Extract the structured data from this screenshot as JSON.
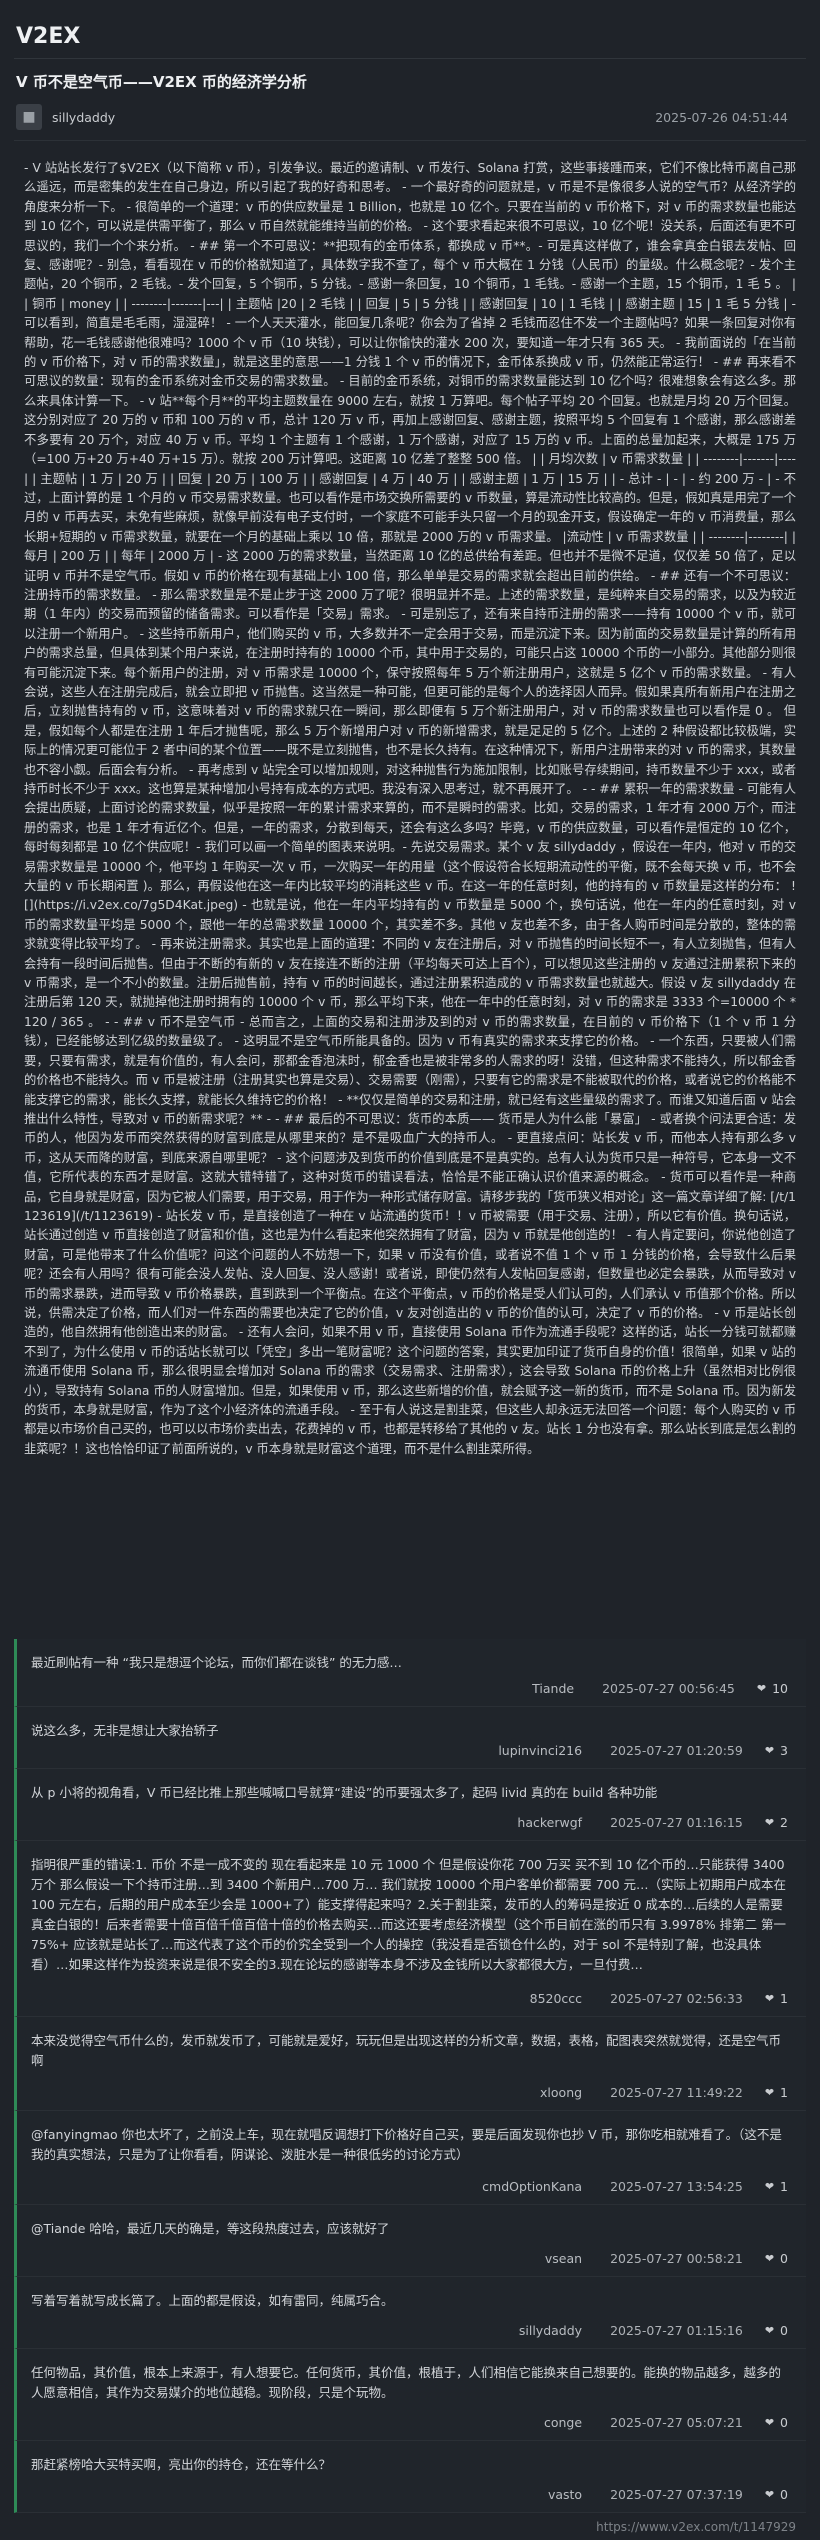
{
  "site": {
    "logo": "V2EX"
  },
  "topic": {
    "title": "V 币不是空气币——V2EX 币的经济学分析",
    "author": "sillydaddy",
    "date": "2025-07-26 04:51:44",
    "body": "- V 站站长发行了$V2EX（以下简称 v 币），引发争议。最近的邀请制、v 币发行、Solana 打赏，这些事接踵而来，它们不像比特币离自己那么遥远，而是密集的发生在自己身边，所以引起了我的好奇和思考。 - 一个最好奇的问题就是，v 币是不是像很多人说的空气币？从经济学的角度来分析一下。 - 很简单的一个道理：v 币的供应数量是 1 Billion，也就是 10 亿个。只要在当前的 v 币价格下，对 v 币的需求数量也能达到 10 亿个，可以说是供需平衡了，那么 v 币自然就能维持当前的价格。 - 这个要求看起来很不可思议，10 亿个呢！没关系，后面还有更不可思议的，我们一个个来分析。 - ## 第一个不可思议：**把现有的金币体系，都换成 v 币**。- 可是真这样做了，谁会拿真金白银去发帖、回复、感谢呢？- 别急，看看现在 v 币的价格就知道了，具体数字我不查了，每个 v 币大概在 1 分钱（人民币）的量级。什么概念呢？- 发个主题帖，20 个铜币，2 毛钱。- 发个回复，5 个铜币，5 分钱。- 感谢一条回复，10 个铜币，1 毛钱。- 感谢一个主题，15 个铜币，1 毛 5 。 | | 铜币 | money | | --------|-------|---| | 主题帖 |20 | 2 毛钱 | | 回复 | 5 | 5 分钱 | | 感谢回复 | 10 | 1 毛钱 | | 感谢主题 | 15 | 1 毛 5 分钱 | - 可以看到，简直是毛毛雨，湿湿碎！ - 一个人天天灌水，能回复几条呢？你会为了省掉 2 毛钱而忍住不发一个主题帖吗？如果一条回复对你有帮助，花一毛钱感谢他很难吗？1000 个 v 币（10 块钱），可以让你愉快的灌水 200 次，要知道一年才只有 365 天。 - 我前面说的「在当前的 v 币价格下，对 v 币的需求数量」，就是这里的意思——1 分钱 1 个 v 币的情况下，金币体系换成 v 币，仍然能正常运行！ - ## 再来看不可思议的数量：现有的金币系统对金币交易的需求数量。 - 目前的金币系统，对铜币的需求数量能达到 10 亿个吗？很难想象会有这么多。那么来具体计算一下。 - v 站**每个月**的平均主题数量在 9000 左右，就按 1 万算吧。每个帖子平均 20 个回复。也就是月均 20 万个回复。这分别对应了 20 万的 v 币和 100 万的 v 币，总计 120 万 v 币，再加上感谢回复、感谢主题，按照平均 5 个回复有 1 个感谢，那么感谢差不多要有 20 万个，对应 40 万 v 币。平均 1 个主题有 1 个感谢，1 万个感谢，对应了 15 万的 v 币。上面的总量加起来，大概是 175 万（=100 万+20 万+40 万+15 万）。就按 200 万计算吧。这距离 10 亿差了整整 500 倍。 | | 月均次数 | v 币需求数量 | | --------|-------|----| | 主题帖 | 1 万 | 20 万 | | 回复 | 20 万 | 100 万 | | 感谢回复 | 4 万 | 40 万 | | 感谢主题 | 1 万 | 15 万 | | - 总计 - | - | - 约 200 万 - | - 不过，上面计算的是 1 个月的 v 币交易需求数量。也可以看作是市场交换所需要的 v 币数量，算是流动性比较高的。但是，假如真是用完了一个月的 v 币再去买，未免有些麻烦，就像早前没有电子支付时，一个家庭不可能手头只留一个月的现金开支，假设确定一年的 v 币消费量，那么长期+短期的 v 币需求数量，就要在一个月的基础上乘以 10 倍，那就是 2000 万的 v 币需求量。 |流动性 | v 币需求数量 | | --------|--------| | 每月 | 200 万 | | 每年 | 2000 万 | - 这 2000 万的需求数量，当然距离 10 亿的总供给有差距。但也并不是微不足道，仅仅差 50 倍了，足以证明 v 币并不是空气币。假如 v 币的价格在现有基础上小 100 倍，那么单单是交易的需求就会超出目前的供给。 - ## 还有一个不可思议：注册持币的需求数量。 - 那么需求数量是不是止步于这 2000 万了呢？很明显并不是。上述的需求数量，是纯粹来自交易的需求，以及为较近期（1 年内）的交易而预留的储备需求。可以看作是「交易」需求。 - 可是别忘了，还有来自持币注册的需求——持有 10000 个 v 币，就可以注册一个新用户。 - 这些持币新用户，他们购买的 v 币，大多数并不一定会用于交易，而是沉淀下来。因为前面的交易数量是计算的所有用户的需求总量，但具体到某个用户来说，在注册时持有的 10000 个币，其中用于交易的，可能只占这 10000 个币的一小部分。其他部分则很有可能沉淀下来。每个新用户的注册，对 v 币需求是 10000 个，保守按照每年 5 万个新注册用户，这就是 5 亿个 v 币的需求数量。 - 有人会说，这些人在注册完成后，就会立即把 v 币抛售。这当然是一种可能，但更可能的是每个人的选择因人而异。假如果真所有新用户在注册之后，立刻抛售持有的 v 币，这意味着对 v 币的需求就只在一瞬间，那么即便有 5 万个新注册用户，对 v 币的需求数量也可以看作是 0 。 但是，假如每个人都是在注册 1 年后才抛售呢，那么 5 万个新增用户对 v 币的新增需求，就是足足的 5 亿个。上述的 2 种假设都比较极端，实际上的情况更可能位于 2 者中间的某个位置——既不是立刻抛售，也不是长久持有。在这种情况下，新用户注册带来的对 v 币的需求，其数量也不容小觑。后面会有分析。 - 再考虑到 v 站完全可以增加规则，对这种抛售行为施加限制，比如账号存续期间，持币数量不少于 xxx，或者持币时长不少于 xxx。这也算是某种增加小号持有成本的方式吧。我没有深入思考过，就不再展开了。 - - ## 累积一年的需求数量 - 可能有人会提出质疑，上面讨论的需求数量，似乎是按照一年的累计需求来算的，而不是瞬时的需求。比如，交易的需求，1 年才有 2000 万个，而注册的需求，也是 1 年才有近亿个。但是，一年的需求，分散到每天，还会有这么多吗？毕竟，v 币的供应数量，可以看作是恒定的 10 亿个，每时每刻都是 10 亿个供应呢！- 我们可以画一个简单的图表来说明。- 先说交易需求。某个 v 友 sillydaddy ，假设在一年内，他对 v 币的交易需求数量是 10000 个，他平均 1 年购买一次 v 币，一次购买一年的用量（这个假设符合长短期流动性的平衡，既不会每天换 v 币，也不会大量的 v 币长期闲置 )。那么，再假设他在这一年内比较平均的消耗这些 v 币。在这一年的任意时刻，他的持有的 v 币数量是这样的分布： ![](https://i.v2ex.co/7g5D4Kat.jpeg) - 也就是说，他在一年内平均持有的 v 币数量是 5000 个，换句话说，他在一年内的任意时刻，对 v 币的需求数量平均是 5000 个，跟他一年的总需求数量 10000 个，其实差不多。其他 v 友也差不多，由于各人购币时间是分散的，整体的需求就变得比较平均了。 - 再来说注册需求。其实也是上面的道理：不同的 v 友在注册后，对 v 币抛售的时间长短不一，有人立刻抛售，但有人会持有一段时间后抛售。但由于不断的有新的 v 友在接连不断的注册（平均每天可达上百个），可以想见这些注册的 v 友通过注册累积下来的 v 币需求，是一个不小的数量。注册后抛售前，持有 v 币的时间越长，通过注册累积造成的 v 币需求数量也就越大。假设 v 友 sillydaddy 在注册后第 120 天，就抛掉他注册时拥有的 10000 个 v 币，那么平均下来，他在一年中的任意时刻，对 v 币的需求是 3333 个=10000 个 * 120 / 365 。 - - ## v 币不是空气币 - 总而言之，上面的交易和注册涉及到的对 v 币的需求数量，在目前的 v 币价格下（1 个 v 币 1 分钱），已经能够达到亿级的数量级了。 - 这明显不是空气币所能具备的。因为 v 币有真实的需求来支撑它的价格。 - 一个东西，只要被人们需要，只要有需求，就是有价值的，有人会问，那都金香泡沫时，郁金香也是被非常多的人需求的呀！没错，但这种需求不能持久，所以郁金香的价格也不能持久。而 v 币是被注册（注册其实也算是交易）、交易需要（刚需），只要有它的需求是不能被取代的价格，或者说它的价格能不能支撑它的需求，能长久支撑，就能长久维持它的价格！ - **仅仅是简单的交易和注册，就已经有这些量级的需求了。而谁又知道后面 v 站会推出什么特性，导致对 v 币的新需求呢？** - - ## 最后的不可思议：货币的本质—— 货币是人为什么能「暴富」 - 或者换个问法更合适：发币的人，他因为发币而突然获得的财富到底是从哪里来的？是不是吸血广大的持币人。 - 更直接点问：站长发 v 币，而他本人持有那么多 v 币，这从天而降的财富，到底来源自哪里呢？ - 这个问题涉及到货币的价值到底是不是真实的。总有人认为货币只是一种符号，它本身一文不值，它所代表的东西才是财富。这就大错特错了，这种对货币的错误看法，恰恰是不能正确认识价值来源的概念。 - 货币可以看作是一种商品，它自身就是财富，因为它被人们需要，用于交易，用于作为一种形式储存财富。请移步我的「货币狭义相对论」这一篇文章详细了解: [/t/1123619](/t/1123619) - 站长发 v 币，是直接创造了一种在 v 站流通的货币！！v 币被需要（用于交易、注册），所以它有价值。换句话说，站长通过创造 v 币直接创造了财富和价值，这也是为什么看起来他突然拥有了财富，因为 v 币就是他创造的！ - 有人肯定要问，你说他创造了财富，可是他带来了什么价值呢？问这个问题的人不妨想一下，如果 v 币没有价值，或者说不值 1 个 v 币 1 分钱的价格，会导致什么后果呢？还会有人用吗？很有可能会没人发帖、没人回复、没人感谢！或者说，即使仍然有人发帖回复感谢，但数量也必定会暴跌，从而导致对 v 币的需求暴跌，进而导致 v 币价格暴跌，直到跌到一个平衡点。在这个平衡点，v 币的价格是受人们认可的，人们承认 v 币值那个价格。所以说，供需决定了价格，而人们对一件东西的需要也决定了它的价值，v 友对创造出的 v 币的价值的认可，决定了 v 币的价格。 - v 币是站长创造的，他自然拥有他创造出来的财富。 - 还有人会问，如果不用 v 币，直接使用 Solana 币作为流通手段呢？这样的话，站长一分钱可就都赚不到了，为什么使用 v 币的话站长就可以「凭空」多出一笔财富呢？这个问题的答案，其实更加印证了货币自身的价值！很简单，如果 v 站的流通币使用 Solana 币，那么很明显会增加对 Solana 币的需求（交易需求、注册需求），这会导致 Solana 币的价格上升（虽然相对比例很小），导致持有 Solana 币的人财富增加。但是，如果使用 v 币，那么这些新增的价值，就会赋予这一新的货币，而不是 Solana 币。因为新发的货币，本身就是财富，作为了这个小经济体的流通手段。 - 至于有人说这是割韭菜，但这些人却永远无法回答一个问题：每个人购买的 v 币都是以市场价自己买的，也可以以市场价卖出去，花费掉的 v 币，也都是转移给了其他的 v 友。站长 1 分也没有拿。那么站长到底是怎么割的韭菜呢？！这也恰恰印证了前面所说的，v 币本身就是财富这个道理，而不是什么割韭菜所得。"
  },
  "replies": [
    {
      "text": "最近刷帖有一种 “我只是想逗个论坛，而你们都在谈钱” 的无力感…",
      "author": "Tiande",
      "time": "2025-07-27 00:56:45",
      "likes": "10"
    },
    {
      "text": "说这么多，无非是想让大家抬轿子",
      "author": "lupinvinci216",
      "time": "2025-07-27 01:20:59",
      "likes": "3"
    },
    {
      "text": "从 p 小将的视角看，V 币已经比推上那些喊喊口号就算“建设”的币要强太多了，起码 livid 真的在 build 各种功能",
      "author": "hackerwgf",
      "time": "2025-07-27 01:16:15",
      "likes": "2"
    },
    {
      "text": "指明很严重的错误:1. 币价 不是一成不变的 现在看起来是 10 元 1000 个 但是假设你花 700 万买 买不到 10 亿个币的…只能获得 3400 万个 那么假设一下个持币注册…到 3400 个新用户…700 万… 我们就按 10000 个用户客单价都需要 700 元…（实际上初期用户成本在 100 元左右，后期的用户成本至少会是 1000+了）能支撑得起来吗？2.关于割韭菜，发币的人的筹码是按近 0 成本的…后续的人是需要真金白银的！后来者需要十倍百倍千倍百倍十倍的价格去购买…而这还要考虑经济模型（这个币目前在涨的币只有 3.9978% 排第二 第一 75%+ 应该就是站长了…而这代表了这个币的价究全受到一个人的操控（我没看是否锁仓什么的，对于 sol 不是特别了解，也没具体看）…如果这样作为投资来说是很不安全的3.现在论坛的感谢等本身不涉及金钱所以大家都很大方，一旦付费…",
      "author": "8520ccc",
      "time": "2025-07-27 02:56:33",
      "likes": "1"
    },
    {
      "text": "本来没觉得空气币什么的，发币就发币了，可能就是爱好，玩玩但是出现这样的分析文章，数据，表格，配图表突然就觉得，还是空气币啊",
      "author": "xloong",
      "time": "2025-07-27 11:49:22",
      "likes": "1"
    },
    {
      "text": "@fanyingmao 你也太坏了，之前没上车，现在就唱反调想打下价格好自己买，要是后面发现你也抄 V 币，那你吃相就难看了。（这不是我的真实想法，只是为了让你看看，阴谋论、泼脏水是一种很低劣的讨论方式）",
      "author": "cmdOptionKana",
      "time": "2025-07-27 13:54:25",
      "likes": "1"
    },
    {
      "text": "@Tiande 哈哈，最近几天的确是，等这段热度过去，应该就好了",
      "author": "vsean",
      "time": "2025-07-27 00:58:21",
      "likes": "0"
    },
    {
      "text": "写着写着就写成长篇了。上面的都是假设，如有雷同，纯属巧合。",
      "author": "sillydaddy",
      "time": "2025-07-27 01:15:16",
      "likes": "0"
    },
    {
      "text": "任何物品，其价值，根本上来源于，有人想要它。任何货币，其价值，根植于，人们相信它能换来自己想要的。能换的物品越多，越多的人愿意相信，其作为交易媒介的地位越稳。现阶段，只是个玩物。",
      "author": "conge",
      "time": "2025-07-27 05:07:21",
      "likes": "0"
    },
    {
      "text": "那赶紧榜哈大买特买啊，亮出你的持仓，还在等什么？",
      "author": "vasto",
      "time": "2025-07-27 07:37:19",
      "likes": "0"
    }
  ],
  "footer": {
    "url": "https://www.v2ex.com/t/1147929"
  },
  "icons": {
    "heart": "heart-icon",
    "avatar": "avatar-icon"
  }
}
